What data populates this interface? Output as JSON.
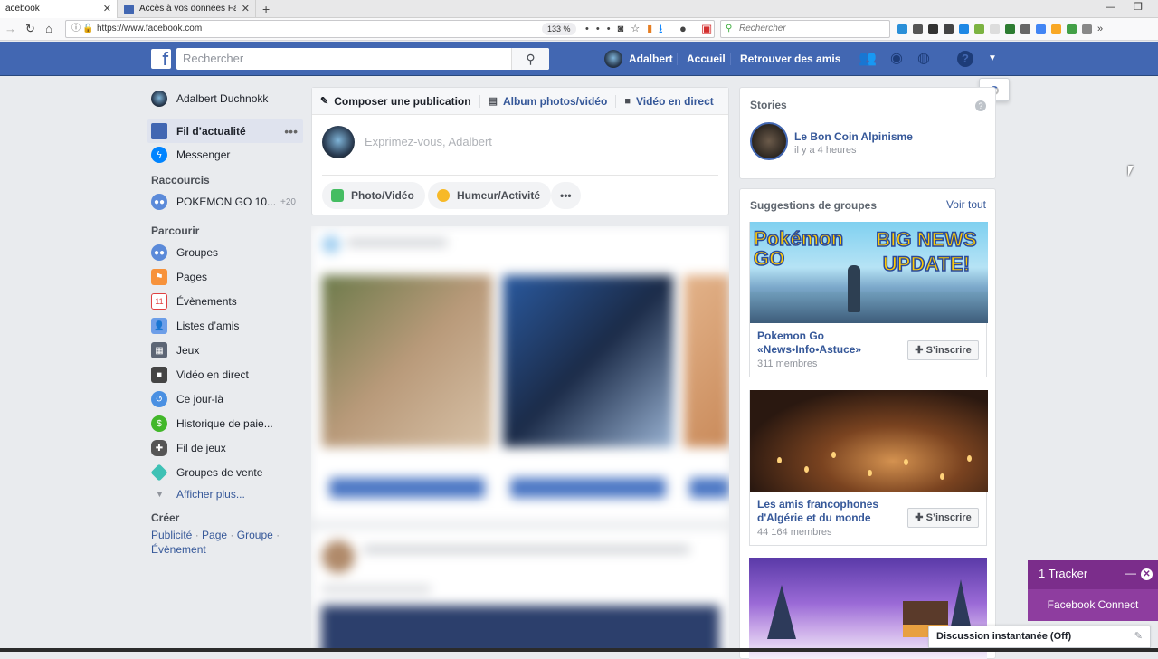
{
  "browser": {
    "tabs": [
      {
        "title": "acebook"
      },
      {
        "title": "Accès à vos données Facebook"
      }
    ],
    "url": "https://www.facebook.com",
    "zoom": "133 %",
    "search_placeholder": "Rechercher"
  },
  "fb_header": {
    "search_placeholder": "Rechercher",
    "user_name": "Adalbert",
    "home_label": "Accueil",
    "find_friends_label": "Retrouver des amis"
  },
  "left_sidebar": {
    "profile_name": "Adalbert Duchnokk",
    "main_items": [
      {
        "label": "Fil d’actualité"
      },
      {
        "label": "Messenger"
      }
    ],
    "shortcuts_title": "Raccourcis",
    "shortcuts": [
      {
        "label": "POKEMON GO 10...",
        "count": "+20"
      }
    ],
    "explore_title": "Parcourir",
    "explore_items": [
      {
        "label": "Groupes",
        "icon": "groups-icon"
      },
      {
        "label": "Pages",
        "icon": "pages-flag-icon"
      },
      {
        "label": "Évènements",
        "icon": "calendar-icon",
        "icon_text": "11"
      },
      {
        "label": "Listes d’amis",
        "icon": "friend-lists-icon"
      },
      {
        "label": "Jeux",
        "icon": "games-icon"
      },
      {
        "label": "Vidéo en direct",
        "icon": "live-video-icon"
      },
      {
        "label": "Ce jour-là",
        "icon": "on-this-day-icon"
      },
      {
        "label": "Historique de paie...",
        "icon": "payment-history-icon"
      },
      {
        "label": "Fil de jeux",
        "icon": "gamepad-icon"
      },
      {
        "label": "Groupes de vente",
        "icon": "sale-tag-icon"
      }
    ],
    "see_more": "Afficher plus...",
    "create_title": "Créer",
    "create_links": [
      "Publicité",
      "Page",
      "Groupe",
      "Évènement"
    ]
  },
  "composer": {
    "tabs": [
      {
        "label": "Composer une publication"
      },
      {
        "label": "Album photos/vidéo"
      },
      {
        "label": "Vidéo en direct"
      }
    ],
    "placeholder": "Exprimez-vous, Adalbert",
    "actions": [
      {
        "label": "Photo/Vidéo"
      },
      {
        "label": "Humeur/Activité"
      },
      {
        "label": "•••"
      }
    ]
  },
  "stories": {
    "title": "Stories",
    "items": [
      {
        "name": "Le Bon Coin Alpinisme",
        "time": "il y a 4 heures"
      }
    ]
  },
  "group_suggestions": {
    "title": "Suggestions de groupes",
    "see_all": "Voir tout",
    "join_label": "S’inscrire",
    "groups": [
      {
        "name": "Pokemon Go «News•Info•Astuce»",
        "members": "311 membres",
        "banner_left": "Pokémon GO",
        "banner_right": "BIG NEWS UPDATE!"
      },
      {
        "name": "Les amis francophones d'Algérie et du monde",
        "members": "44 164 membres"
      },
      {
        "name": "",
        "members": ""
      }
    ]
  },
  "tracker_popup": {
    "title": "1 Tracker",
    "subtitle": "Facebook Connect"
  },
  "chat": {
    "label": "Discussion instantanée (Off)"
  },
  "colors": {
    "fb_blue": "#4267b2",
    "link": "#365899",
    "tracker_purple": "#7b2d8b"
  }
}
